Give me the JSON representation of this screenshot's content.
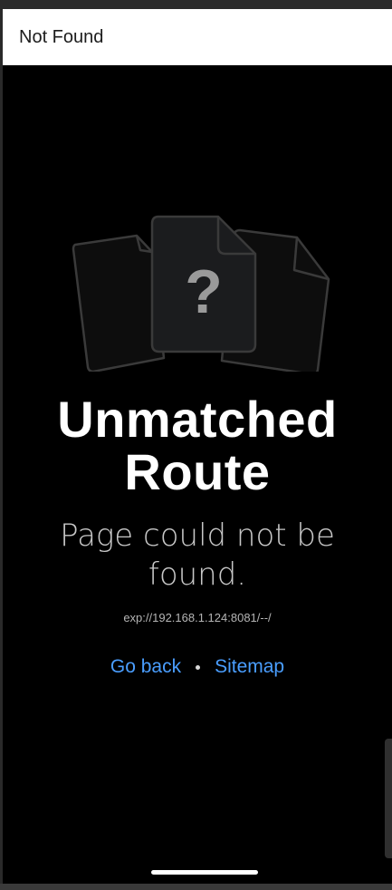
{
  "header": {
    "title": "Not Found"
  },
  "illustration": {
    "center_glyph": "?",
    "icons": [
      "document-left-icon",
      "document-question-icon",
      "document-right-icon"
    ]
  },
  "main": {
    "title_line1": "Unmatched",
    "title_line2": "Route",
    "subtitle_line1": "Page could not be",
    "subtitle_line2": "found.",
    "url": "exp://192.168.1.124:8081/--/"
  },
  "links": {
    "go_back": "Go back",
    "sitemap": "Sitemap"
  },
  "colors": {
    "background": "#000000",
    "header_background": "#ffffff",
    "link": "#4a9eff",
    "illustration_stroke": "#3a3a3a",
    "illustration_fill": "#1b1c1e",
    "question_mark": "#9a9a9a"
  }
}
